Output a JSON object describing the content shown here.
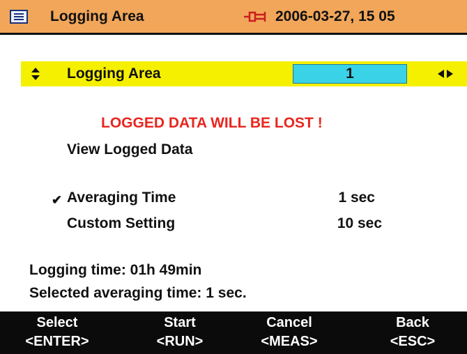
{
  "header": {
    "title": "Logging Area",
    "datetime": "2006-03-27, 15 05",
    "menu_icon": "menu-icon",
    "power_icon": "plug-icon",
    "color": "#f2a65a"
  },
  "selected_row": {
    "label": "Logging Area",
    "value": "1",
    "highlight_color": "#f5f000",
    "value_box_color": "#3ad2e6"
  },
  "warning": {
    "text": "LOGGED DATA WILL BE LOST !",
    "color": "#e8261f"
  },
  "menu": {
    "view_logged": "View Logged Data"
  },
  "settings": [
    {
      "label": "Averaging Time",
      "value": "1 sec",
      "checked": true
    },
    {
      "label": "Custom Setting",
      "value": "10 sec",
      "checked": false
    }
  ],
  "info": {
    "logging_time": "Logging time: 01h 49min",
    "selected_avg": "Selected averaging time: 1 sec."
  },
  "softkeys": [
    {
      "label": "Select",
      "key": "<ENTER>"
    },
    {
      "label": "Start",
      "key": "<RUN>"
    },
    {
      "label": "Cancel",
      "key": "<MEAS>"
    },
    {
      "label": "Back",
      "key": "<ESC>"
    }
  ]
}
